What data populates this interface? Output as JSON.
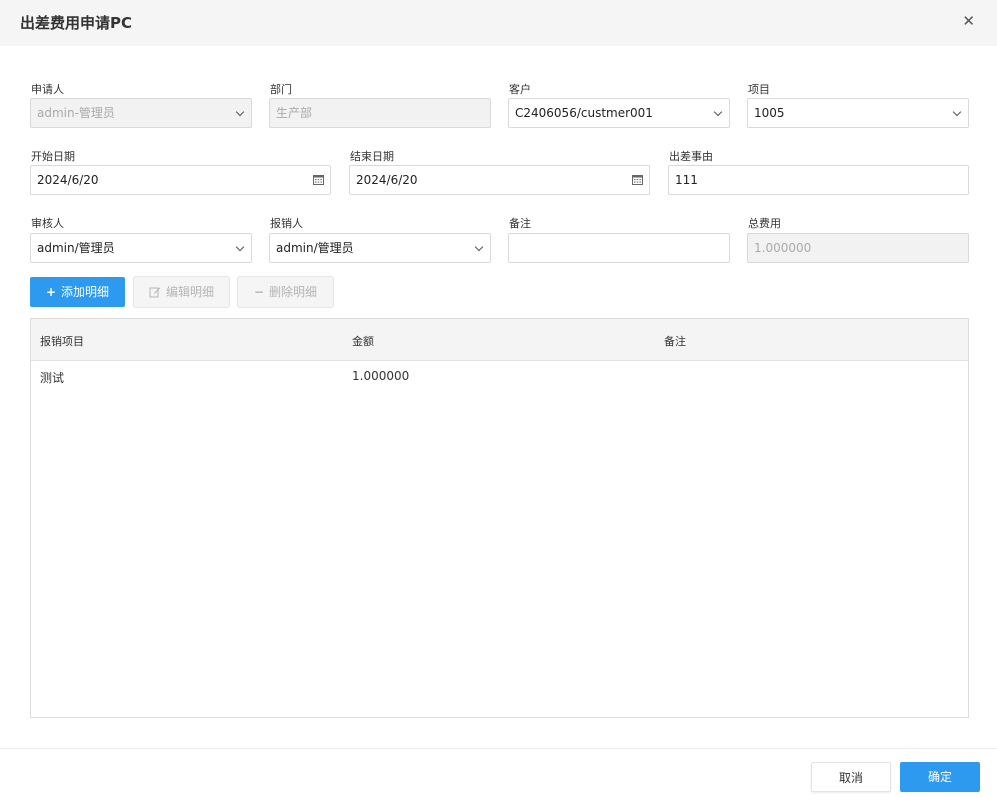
{
  "dialog": {
    "title": "出差费用申请PC",
    "close_glyph": "✕"
  },
  "form": {
    "applicant": {
      "label": "申请人",
      "value": "admin-管理员"
    },
    "department": {
      "label": "部门",
      "value": "生产部"
    },
    "customer": {
      "label": "客户",
      "value": "C2406056/custmer001"
    },
    "project": {
      "label": "项目",
      "value": "1005"
    },
    "start_date": {
      "label": "开始日期",
      "value": "2024/6/20"
    },
    "end_date": {
      "label": "结束日期",
      "value": "2024/6/20"
    },
    "reason": {
      "label": "出差事由",
      "value": "111"
    },
    "reviewer": {
      "label": "审核人",
      "value": "admin/管理员"
    },
    "reimburser": {
      "label": "报销人",
      "value": "admin/管理员"
    },
    "remark": {
      "label": "备注",
      "value": ""
    },
    "total": {
      "label": "总费用",
      "value": "1.000000"
    }
  },
  "toolbar": {
    "add_label": "添加明细",
    "edit_label": "编辑明细",
    "delete_label": "删除明细"
  },
  "table": {
    "columns": [
      "报销项目",
      "金额",
      "备注"
    ],
    "rows": [
      [
        "测试",
        "1.000000",
        ""
      ]
    ]
  },
  "footer": {
    "cancel_label": "取消",
    "ok_label": "确定"
  },
  "colors": {
    "primary": "#2d9af0",
    "header_bg": "#f5f5f5"
  }
}
